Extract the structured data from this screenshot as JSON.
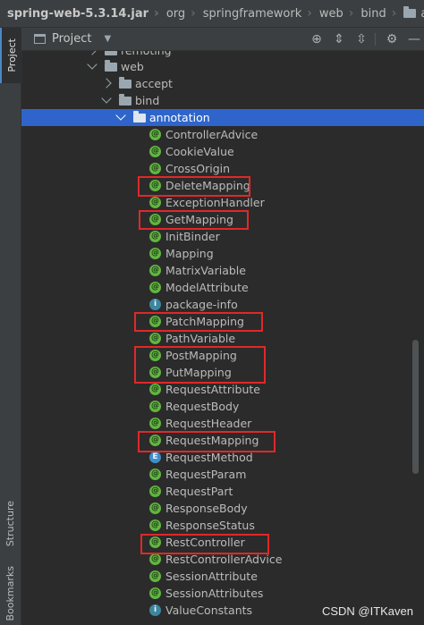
{
  "breadcrumb": {
    "items": [
      "spring-web-5.3.14.jar",
      "org",
      "springframework",
      "web",
      "bind",
      "annotation"
    ]
  },
  "side_strip": {
    "tabs": [
      "Project",
      "Structure",
      "Bookmarks"
    ]
  },
  "project_panel": {
    "title": "Project",
    "toolbar_icons": [
      "locate-icon",
      "expand-all-icon",
      "collapse-all-icon",
      "settings-icon",
      "hide-icon"
    ]
  },
  "tree": {
    "folders": [
      {
        "label": "remoting",
        "state": "collapsed"
      },
      {
        "label": "web",
        "state": "expanded"
      },
      {
        "label": "accept",
        "state": "collapsed"
      },
      {
        "label": "bind",
        "state": "expanded"
      },
      {
        "label": "annotation",
        "state": "expanded",
        "selected": true
      }
    ],
    "items": [
      {
        "label": "ControllerAdvice",
        "kind": "annotation"
      },
      {
        "label": "CookieValue",
        "kind": "annotation"
      },
      {
        "label": "CrossOrigin",
        "kind": "annotation"
      },
      {
        "label": "DeleteMapping",
        "kind": "annotation",
        "highlighted": true
      },
      {
        "label": "ExceptionHandler",
        "kind": "annotation"
      },
      {
        "label": "GetMapping",
        "kind": "annotation",
        "highlighted": true
      },
      {
        "label": "InitBinder",
        "kind": "annotation"
      },
      {
        "label": "Mapping",
        "kind": "annotation"
      },
      {
        "label": "MatrixVariable",
        "kind": "annotation"
      },
      {
        "label": "ModelAttribute",
        "kind": "annotation"
      },
      {
        "label": "package-info",
        "kind": "info"
      },
      {
        "label": "PatchMapping",
        "kind": "annotation",
        "highlighted": true
      },
      {
        "label": "PathVariable",
        "kind": "annotation"
      },
      {
        "label": "PostMapping",
        "kind": "annotation",
        "highlighted": true
      },
      {
        "label": "PutMapping",
        "kind": "annotation",
        "highlighted": true
      },
      {
        "label": "RequestAttribute",
        "kind": "annotation"
      },
      {
        "label": "RequestBody",
        "kind": "annotation"
      },
      {
        "label": "RequestHeader",
        "kind": "annotation"
      },
      {
        "label": "RequestMapping",
        "kind": "annotation",
        "highlighted": true
      },
      {
        "label": "RequestMethod",
        "kind": "enum"
      },
      {
        "label": "RequestParam",
        "kind": "annotation"
      },
      {
        "label": "RequestPart",
        "kind": "annotation"
      },
      {
        "label": "ResponseBody",
        "kind": "annotation"
      },
      {
        "label": "ResponseStatus",
        "kind": "annotation"
      },
      {
        "label": "RestController",
        "kind": "annotation",
        "highlighted": true
      },
      {
        "label": "RestControllerAdvice",
        "kind": "annotation"
      },
      {
        "label": "SessionAttribute",
        "kind": "annotation"
      },
      {
        "label": "SessionAttributes",
        "kind": "annotation"
      },
      {
        "label": "ValueConstants",
        "kind": "info"
      }
    ]
  },
  "watermark": "CSDN @ITKaven",
  "colors": {
    "highlight_box": "#e02828",
    "selection": "#2f65ca",
    "annotation_icon": "#62b543"
  }
}
